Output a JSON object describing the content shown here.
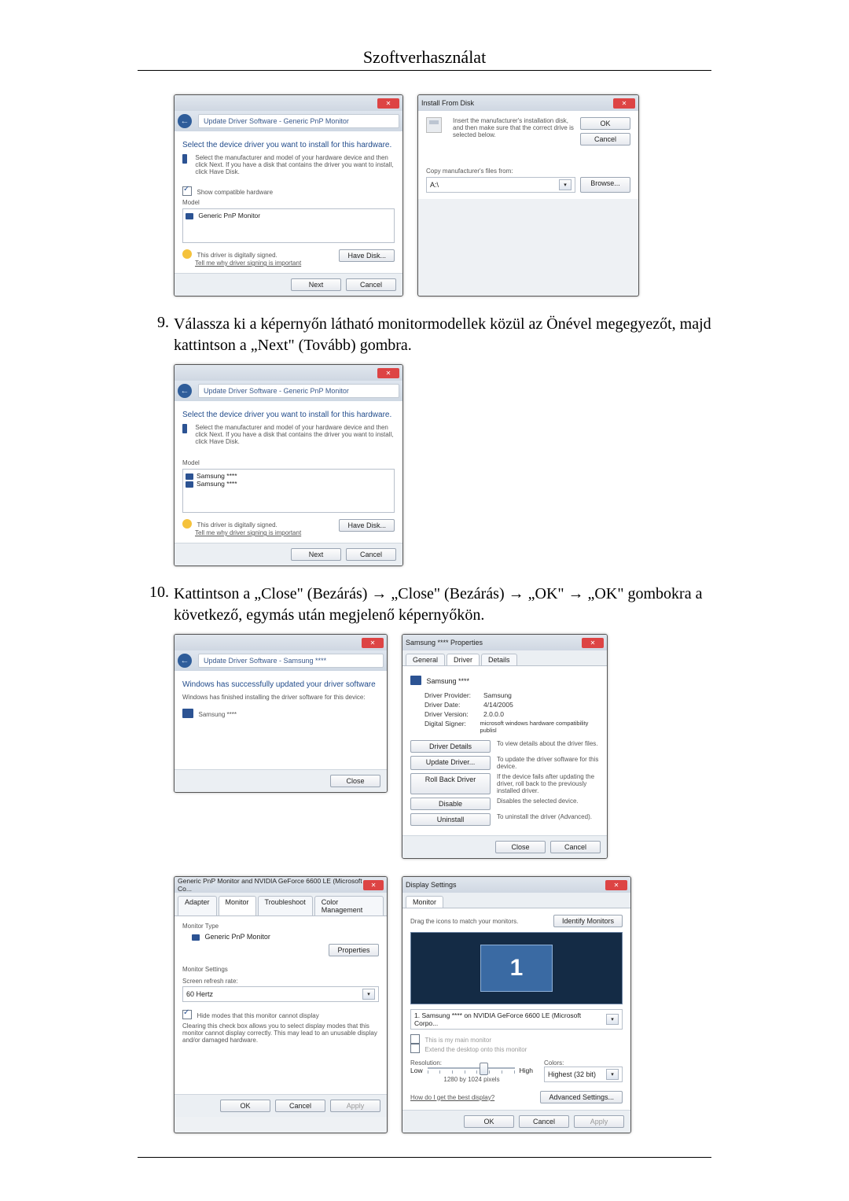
{
  "page_title": "Szoftverhasználat",
  "step9": {
    "num": "9.",
    "text": "Válassza ki a képernyőn látható monitormodellek közül az Önével megegyezőt, majd kattintson a „Next\" (Tovább) gombra."
  },
  "step10": {
    "num": "10.",
    "text": "Kattintson a „Close\" (Bezárás) → „Close\" (Bezárás) → „OK\" → „OK\" gombokra a következő, egymás után megjelenő képernyőkön."
  },
  "win1": {
    "crumb": "Update Driver Software - Generic PnP Monitor",
    "heading": "Select the device driver you want to install for this hardware.",
    "sub": "Select the manufacturer and model of your hardware device and then click Next. If you have a disk that contains the driver you want to install, click Have Disk.",
    "show_compatible": "Show compatible hardware",
    "model_label": "Model",
    "model_item": "Generic PnP Monitor",
    "signed": "This driver is digitally signed.",
    "signed_link": "Tell me why driver signing is important",
    "have_disk": "Have Disk...",
    "next": "Next",
    "cancel": "Cancel"
  },
  "win2": {
    "title": "Install From Disk",
    "msg": "Insert the manufacturer's installation disk, and then make sure that the correct drive is selected below.",
    "ok": "OK",
    "cancel": "Cancel",
    "copy_label": "Copy manufacturer's files from:",
    "drive": "A:\\",
    "browse": "Browse..."
  },
  "win3": {
    "crumb": "Update Driver Software - Generic PnP Monitor",
    "heading": "Select the device driver you want to install for this hardware.",
    "sub": "Select the manufacturer and model of your hardware device and then click Next. If you have a disk that contains the driver you want to install, click Have Disk.",
    "model_label": "Model",
    "model_item1": "Samsung ****",
    "model_item2": "Samsung ****",
    "signed": "This driver is digitally signed.",
    "signed_link": "Tell me why driver signing is important",
    "have_disk": "Have Disk...",
    "next": "Next",
    "cancel": "Cancel"
  },
  "win4": {
    "crumb": "Update Driver Software - Samsung ****",
    "heading": "Windows has successfully updated your driver software",
    "sub": "Windows has finished installing the driver software for this device:",
    "device": "Samsung ****",
    "close": "Close"
  },
  "win5": {
    "title": "Samsung **** Properties",
    "tab_general": "General",
    "tab_driver": "Driver",
    "tab_details": "Details",
    "device": "Samsung ****",
    "dp_k": "Driver Provider:",
    "dp_v": "Samsung",
    "dd_k": "Driver Date:",
    "dd_v": "4/14/2005",
    "dv_k": "Driver Version:",
    "dv_v": "2.0.0.0",
    "ds_k": "Digital Signer:",
    "ds_v": "microsoft windows hardware compatibility publisl",
    "b_details": "Driver Details",
    "t_details": "To view details about the driver files.",
    "b_update": "Update Driver...",
    "t_update": "To update the driver software for this device.",
    "b_roll": "Roll Back Driver",
    "t_roll": "If the device fails after updating the driver, roll back to the previously installed driver.",
    "b_disable": "Disable",
    "t_disable": "Disables the selected device.",
    "b_uninstall": "Uninstall",
    "t_uninstall": "To uninstall the driver (Advanced).",
    "close": "Close",
    "cancel": "Cancel"
  },
  "win6": {
    "title": "Generic PnP Monitor and NVIDIA GeForce 6600 LE (Microsoft Co...",
    "tab_adapter": "Adapter",
    "tab_monitor": "Monitor",
    "tab_trouble": "Troubleshoot",
    "tab_color": "Color Management",
    "montype_label": "Monitor Type",
    "montype_val": "Generic PnP Monitor",
    "properties": "Properties",
    "monset_label": "Monitor Settings",
    "refresh_label": "Screen refresh rate:",
    "refresh_val": "60 Hertz",
    "hide_check": "Hide modes that this monitor cannot display",
    "hide_text": "Clearing this check box allows you to select display modes that this monitor cannot display correctly. This may lead to an unusable display and/or damaged hardware.",
    "ok": "OK",
    "cancel": "Cancel",
    "apply": "Apply"
  },
  "win7": {
    "title": "Display Settings",
    "tab_monitor": "Monitor",
    "drag": "Drag the icons to match your monitors.",
    "identify": "Identify Monitors",
    "mon_num": "1",
    "combo": "1. Samsung **** on NVIDIA GeForce 6600 LE (Microsoft Corpo...",
    "chk1": "This is my main monitor",
    "chk2": "Extend the desktop onto this monitor",
    "res_label": "Resolution:",
    "col_label": "Colors:",
    "low": "Low",
    "high": "High",
    "res_val": "1280 by 1024 pixels",
    "col_val": "Highest (32 bit)",
    "link": "How do I get the best display?",
    "adv": "Advanced Settings...",
    "ok": "OK",
    "cancel": "Cancel",
    "apply": "Apply"
  }
}
